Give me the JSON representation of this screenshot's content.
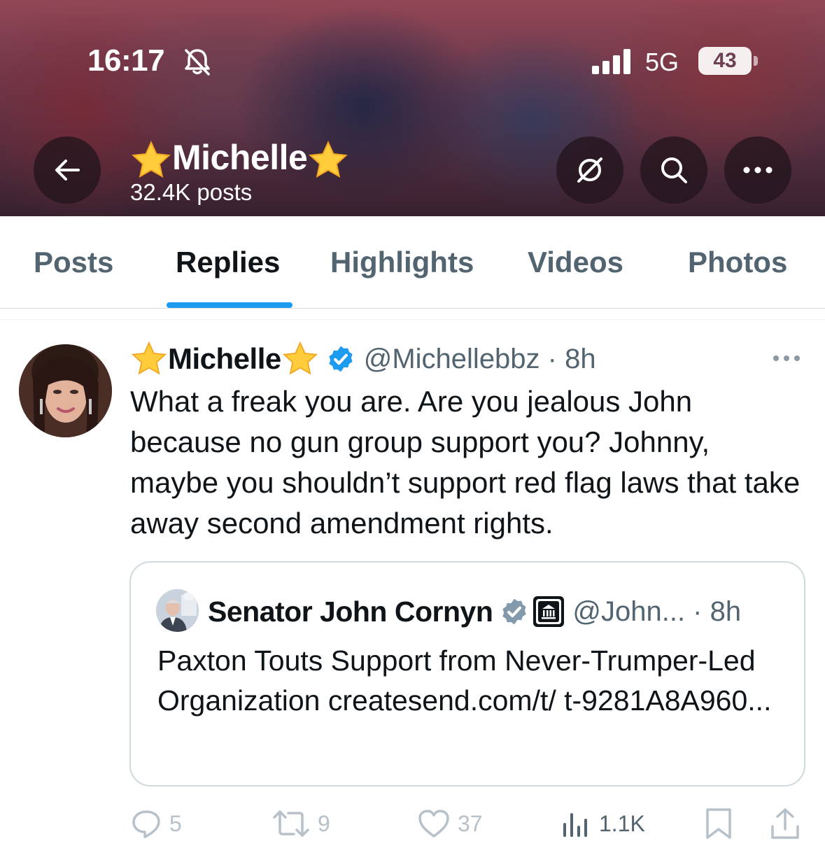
{
  "status_bar": {
    "time": "16:17",
    "network": "5G",
    "battery": "43"
  },
  "header": {
    "name": "Michelle",
    "posts_count": "32.4K posts"
  },
  "tabs": [
    {
      "label": "Posts"
    },
    {
      "label": "Replies"
    },
    {
      "label": "Highlights"
    },
    {
      "label": "Videos"
    },
    {
      "label": "Photos"
    }
  ],
  "active_tab": "Replies",
  "post": {
    "author_name": "Michelle",
    "handle_time": "@Michellebbz · 8h",
    "text": "What a freak you are. Are you jealous John because no gun group support you? Johnny, maybe you shouldn’t support red flag laws that take away second amendment rights.",
    "quote": {
      "author_name": "Senator John Cornyn",
      "handle_time": "@John... · 8h",
      "text": "Paxton Touts Support from Never-Trumper-Led Organization createsend.com/t/ t-9281A8A960..."
    },
    "actions": {
      "replies": "5",
      "reposts": "9",
      "likes": "37",
      "views": "1.1K"
    }
  },
  "colors": {
    "accent": "#1d9bf0",
    "text_primary": "#0f1419",
    "text_secondary": "#536471",
    "verified": "#1d9bf0"
  },
  "icons": [
    "back-arrow-icon",
    "bell-off-icon",
    "signal-icon",
    "mute-icon",
    "search-icon",
    "more-icon",
    "star-icon",
    "verified-badge-icon",
    "government-badge-icon",
    "reply-icon",
    "repost-icon",
    "like-icon",
    "views-icon",
    "bookmark-icon",
    "share-icon"
  ]
}
